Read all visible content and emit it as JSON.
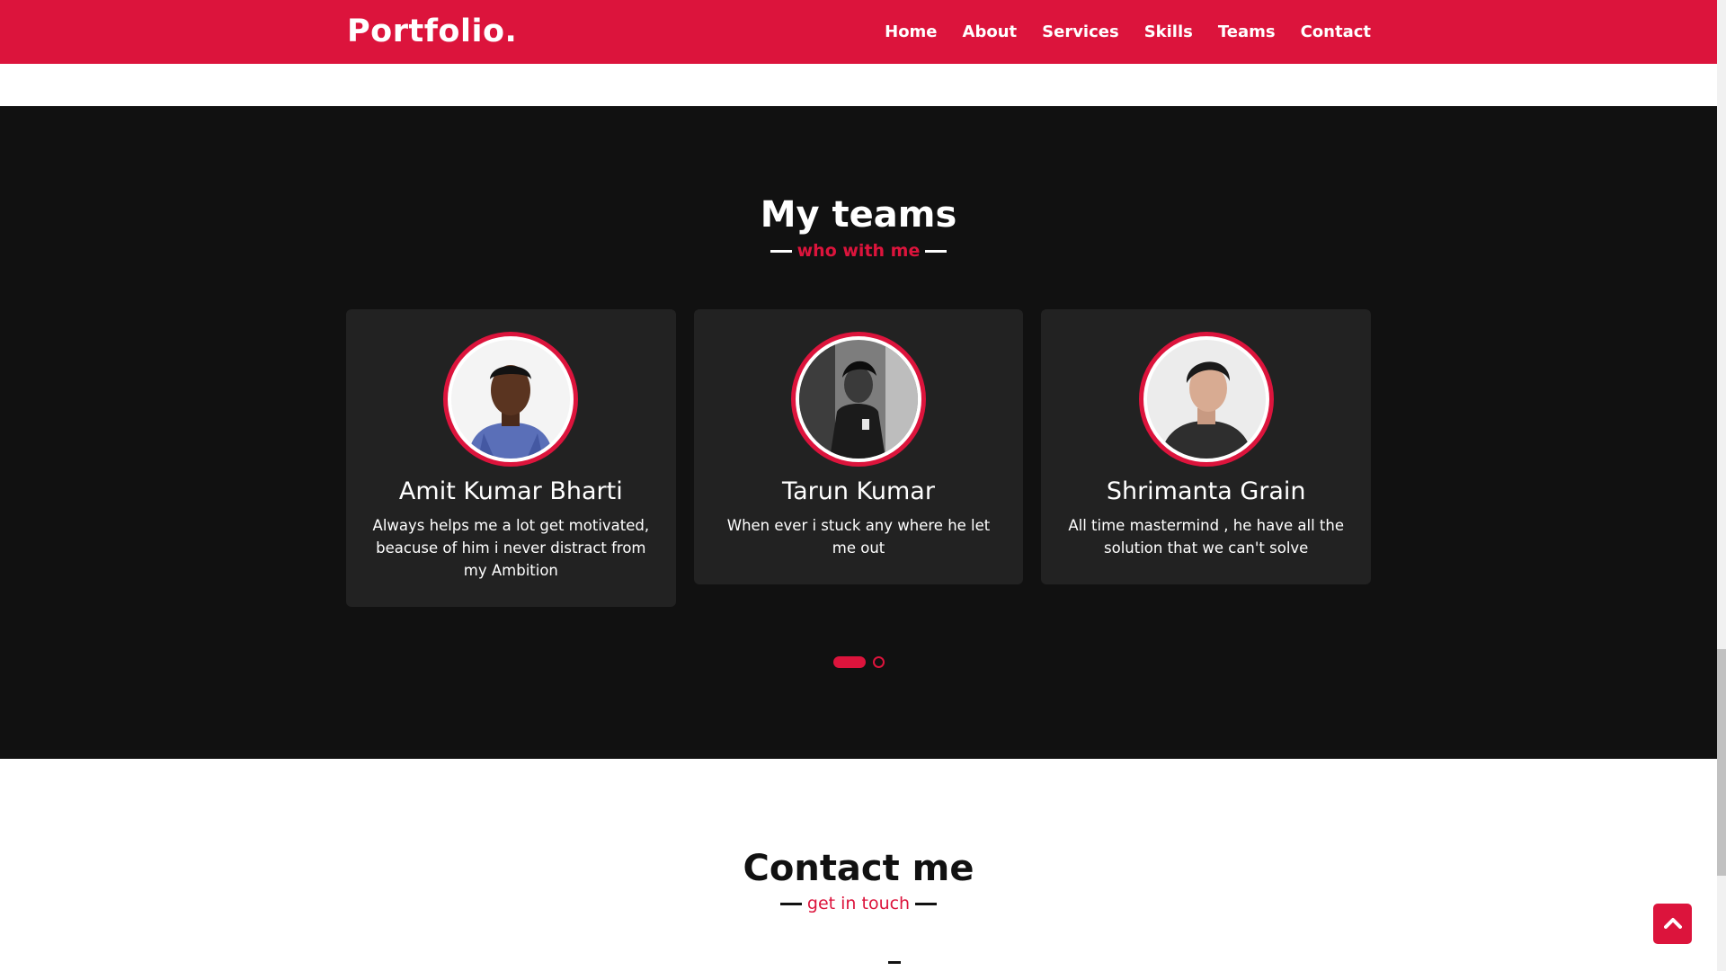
{
  "navbar": {
    "logo": "Portfolio.",
    "menu": [
      "Home",
      "About",
      "Services",
      "Skills",
      "Teams",
      "Contact"
    ]
  },
  "teams": {
    "title": "My teams",
    "subtitle": "who with me",
    "members": [
      {
        "name": "Amit Kumar Bharti",
        "description": "Always helps me a lot get motivated, beacuse of him i never distract from my Ambition"
      },
      {
        "name": "Tarun Kumar",
        "description": "When ever i stuck any where he let me out"
      },
      {
        "name": "Shrimanta Grain",
        "description": "All time mastermind , he have all the solution that we can't solve"
      }
    ],
    "carousel": {
      "pages": 2,
      "active": 1
    }
  },
  "contact": {
    "title": "Contact me",
    "subtitle": "get in touch"
  },
  "colors": {
    "accent": "#dc143c",
    "dark_bg": "#111111",
    "card_bg": "#222222"
  }
}
